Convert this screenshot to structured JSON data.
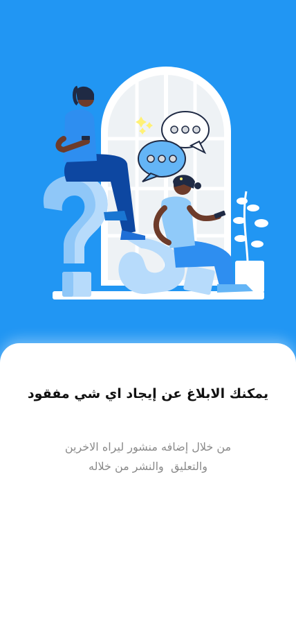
{
  "onboarding": {
    "title": "يمكنك الابلاغ عن إيجاد اي شي مفقود",
    "description_line1": "من خلال إضافه منشور ليراه الاخرين",
    "description_line2": "والتعليق  والنشر من خلاله"
  },
  "colors": {
    "background": "#2196F3",
    "sheet": "#FFFFFF",
    "title_text": "#111111",
    "description_text": "#8A8A8A"
  },
  "illustration": {
    "icons": [
      "question-mark-icon",
      "chat-bubble-icon",
      "plant-icon",
      "sparkle-icon"
    ]
  }
}
